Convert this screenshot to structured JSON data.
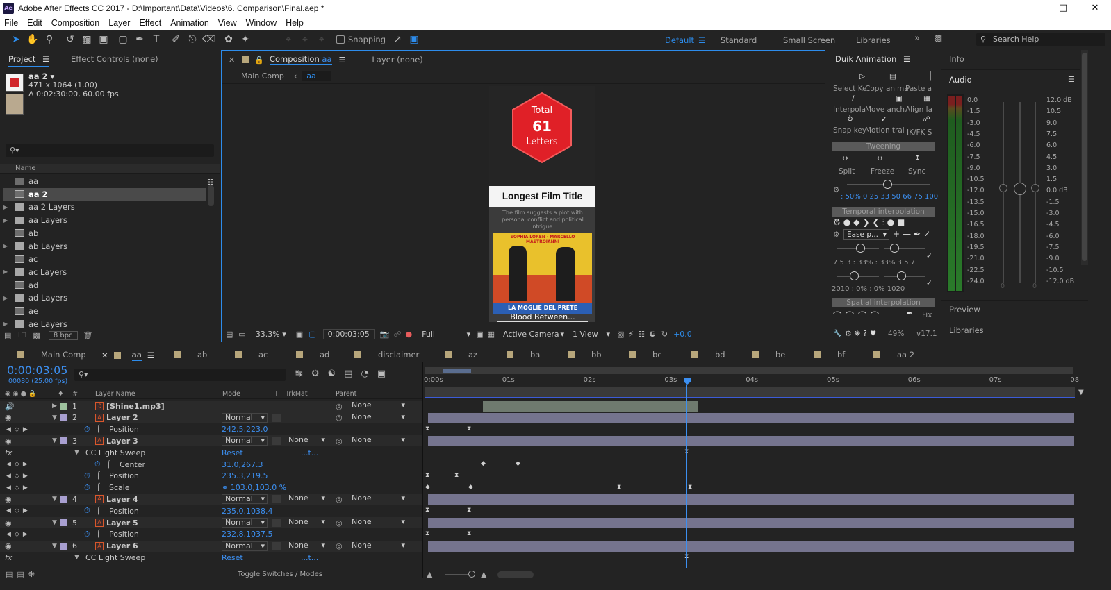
{
  "window": {
    "app_icon": "Ae",
    "title": "Adobe After Effects CC 2017 - D:\\Important\\Data\\Videos\\6. Comparison\\Final.aep *"
  },
  "menu": [
    "File",
    "Edit",
    "Composition",
    "Layer",
    "Effect",
    "Animation",
    "View",
    "Window",
    "Help"
  ],
  "toolbar": {
    "snapping_label": "Snapping",
    "workspaces": [
      "Default",
      "Standard",
      "Small Screen",
      "Libraries"
    ],
    "active_workspace": "Default",
    "search_placeholder": "Search Help"
  },
  "project_panel": {
    "tab_project": "Project",
    "tab_effect_controls": "Effect Controls (none)",
    "item_name": "aa 2 ▾",
    "item_dims": "471 x 1064 (1.00)",
    "item_duration": "Δ 0:02:30:00, 60.00 fps",
    "column_name": "Name",
    "items": [
      {
        "name": "aa",
        "type": "comp",
        "selected": false,
        "expandable": false
      },
      {
        "name": "aa 2",
        "type": "comp",
        "selected": true,
        "expandable": false
      },
      {
        "name": "aa 2 Layers",
        "type": "folder",
        "selected": false,
        "expandable": true
      },
      {
        "name": "aa Layers",
        "type": "folder",
        "selected": false,
        "expandable": true
      },
      {
        "name": "ab",
        "type": "comp",
        "selected": false,
        "expandable": false
      },
      {
        "name": "ab Layers",
        "type": "folder",
        "selected": false,
        "expandable": true
      },
      {
        "name": "ac",
        "type": "comp",
        "selected": false,
        "expandable": false
      },
      {
        "name": "ac Layers",
        "type": "folder",
        "selected": false,
        "expandable": true
      },
      {
        "name": "ad",
        "type": "comp",
        "selected": false,
        "expandable": false
      },
      {
        "name": "ad Layers",
        "type": "folder",
        "selected": false,
        "expandable": true
      },
      {
        "name": "ae",
        "type": "comp",
        "selected": false,
        "expandable": false
      },
      {
        "name": "ae Layers",
        "type": "folder",
        "selected": false,
        "expandable": true
      }
    ],
    "bpc": "8 bpc"
  },
  "comp_panel": {
    "tab_composition": "Composition",
    "tab_comp_name": "aa",
    "tab_layer": "Layer (none)",
    "breadcrumb_main": "Main Comp",
    "breadcrumb_current": "aa",
    "zoom": "33.3%",
    "timecode": "0:00:03:05",
    "resolution": "Full",
    "camera": "Active Camera",
    "views": "1 View",
    "exposure": "+0.0",
    "frame": {
      "badge_top": "Total",
      "badge_number": "61",
      "badge_bottom": "Letters",
      "card_title": "Longest Film Title",
      "card_subtitle": "The film suggests a plot with personal conflict and political intrigue.",
      "poster_top": "SOPHIA LOREN · MARCELLO MASTROIANNI",
      "poster_title": "LA MOGLIE DEL PRETE",
      "caption": "Blood Between..."
    }
  },
  "duik_panel": {
    "title": "Duik Animation",
    "row1": [
      "Select Ke",
      "Copy anima",
      "Paste a"
    ],
    "row2": [
      "Interpola",
      "Move anch",
      "Align la"
    ],
    "row3": [
      "Snap key",
      "Motion trai",
      "IK/FK S"
    ],
    "tweening": "Tweening",
    "tween_buttons": [
      "Split",
      "Freeze",
      "Sync"
    ],
    "percent_row": ": 50%   0  25  33  50  66  75  100",
    "temporal": "Temporal interpolation",
    "ease_select": "Ease p...",
    "ease_values": "7  5  3  :  33%  :  33%    3  5  7",
    "ease_values2": "2010    :  0%  :  0%       1020",
    "spatial": "Spatial interpolation",
    "fix_label": "Fix",
    "percent_footer": "49%",
    "version": "v17.1"
  },
  "right_panel": {
    "info": "Info",
    "audio": "Audio",
    "preview": "Preview",
    "libraries": "Libraries",
    "meter_left": [
      "0.0",
      "-1.5",
      "-3.0",
      "-4.5",
      "-6.0",
      "-7.5",
      "-9.0",
      "-10.5",
      "-12.0",
      "-13.5",
      "-15.0",
      "-16.5",
      "-18.0",
      "-19.5",
      "-21.0",
      "-22.5",
      "-24.0"
    ],
    "meter_right": [
      "12.0 dB",
      "10.5",
      "9.0",
      "7.5",
      "6.0",
      "4.5",
      "3.0",
      "1.5",
      "0.0 dB",
      "-1.5",
      "-3.0",
      "-4.5",
      "-6.0",
      "-7.5",
      "-9.0",
      "-10.5",
      "-12.0 dB"
    ],
    "fader_zeros": [
      "0",
      "0"
    ]
  },
  "timeline": {
    "tabs": [
      "Main Comp",
      "aa",
      "ab",
      "ac",
      "ad",
      "disclaimer",
      "az",
      "ba",
      "bb",
      "bc",
      "bd",
      "be",
      "bf",
      "aa 2"
    ],
    "active_tab": "aa",
    "timecode": "0:00:03:05",
    "frame_info": "00080 (25.00 fps)",
    "columns": {
      "num": "#",
      "layer_name": "Layer Name",
      "mode": "Mode",
      "t": "T",
      "trkmat": "TrkMat",
      "parent": "Parent"
    },
    "ruler": [
      "0:00s",
      "01s",
      "02s",
      "03s",
      "04s",
      "05s",
      "06s",
      "07s",
      "08"
    ],
    "rows": [
      {
        "kind": "layer",
        "num": "1",
        "name": "[Shine1.mp3]",
        "mode": "",
        "trkmat": "",
        "parent": "None"
      },
      {
        "kind": "layer",
        "num": "2",
        "name": "Layer 2",
        "mode": "Normal",
        "trkmat": "",
        "parent": "None"
      },
      {
        "kind": "prop",
        "name": "Position",
        "value": "242.5,223.0"
      },
      {
        "kind": "layer",
        "num": "3",
        "name": "Layer 3",
        "mode": "Normal",
        "trkmat": "None",
        "parent": "None"
      },
      {
        "kind": "effect",
        "name": "CC Light Sweep",
        "value": "Reset",
        "extra": "...t..."
      },
      {
        "kind": "subprop",
        "name": "Center",
        "value": "31.0,267.3"
      },
      {
        "kind": "prop",
        "name": "Position",
        "value": "235.3,219.5"
      },
      {
        "kind": "prop",
        "name": "Scale",
        "value": "⚭  103.0,103.0 %"
      },
      {
        "kind": "layer",
        "num": "4",
        "name": "Layer 4",
        "mode": "Normal",
        "trkmat": "None",
        "parent": "None"
      },
      {
        "kind": "prop",
        "name": "Position",
        "value": "235.0,1038.4"
      },
      {
        "kind": "layer",
        "num": "5",
        "name": "Layer 5",
        "mode": "Normal",
        "trkmat": "None",
        "parent": "None"
      },
      {
        "kind": "prop",
        "name": "Position",
        "value": "232.8,1037.5"
      },
      {
        "kind": "layer",
        "num": "6",
        "name": "Layer 6",
        "mode": "Normal",
        "trkmat": "None",
        "parent": "None"
      },
      {
        "kind": "effect",
        "name": "CC Light Sweep",
        "value": "Reset",
        "extra": "...t..."
      }
    ],
    "toggle_label": "Toggle Switches / Modes"
  }
}
